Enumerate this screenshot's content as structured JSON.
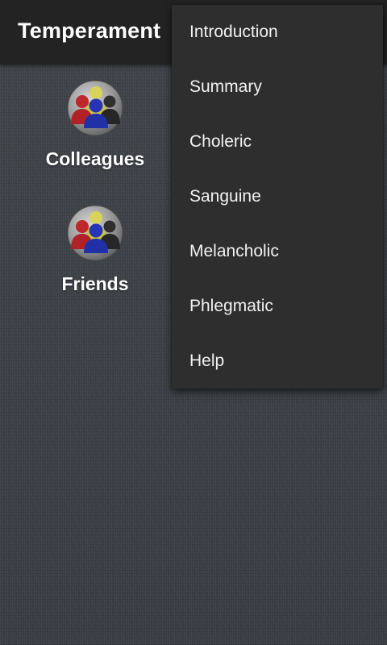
{
  "app_bar": {
    "title": "Temperament"
  },
  "groups": [
    {
      "label": "Colleagues",
      "icon": "people-group-icon"
    },
    {
      "label": "Friends",
      "icon": "people-group-icon"
    }
  ],
  "overflow_menu": {
    "items": [
      {
        "label": "Introduction"
      },
      {
        "label": "Summary"
      },
      {
        "label": "Choleric"
      },
      {
        "label": "Sanguine"
      },
      {
        "label": "Melancholic"
      },
      {
        "label": "Phlegmatic"
      },
      {
        "label": "Help"
      }
    ]
  },
  "colors": {
    "action_bar": "#232323",
    "menu_background": "#2e2e2e",
    "background": "#3d4147",
    "person_red": "#c0272d",
    "person_yellow": "#d8d35a",
    "person_blue": "#2734b5",
    "person_black": "#2a2a2a"
  }
}
